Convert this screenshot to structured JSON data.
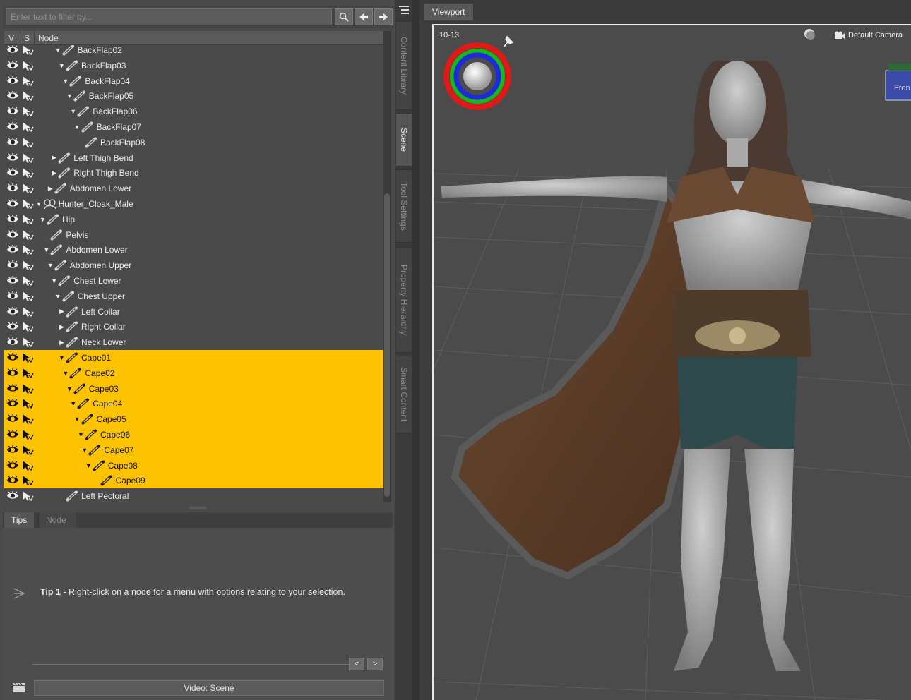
{
  "filter": {
    "placeholder": "Enter text to filter by..."
  },
  "tree_header": {
    "v": "V",
    "s": "S",
    "node": "Node"
  },
  "tree_rows": [
    {
      "label": "BackFlap02",
      "depth": 9,
      "expand": "down",
      "selected": false
    },
    {
      "label": "BackFlap03",
      "depth": 10,
      "expand": "down",
      "selected": false
    },
    {
      "label": "BackFlap04",
      "depth": 11,
      "expand": "down",
      "selected": false
    },
    {
      "label": "BackFlap05",
      "depth": 12,
      "expand": "down",
      "selected": false
    },
    {
      "label": "BackFlap06",
      "depth": 13,
      "expand": "down",
      "selected": false
    },
    {
      "label": "BackFlap07",
      "depth": 14,
      "expand": "down",
      "selected": false
    },
    {
      "label": "BackFlap08",
      "depth": 15,
      "expand": "none",
      "selected": false
    },
    {
      "label": "Left Thigh Bend",
      "depth": 8,
      "expand": "right",
      "selected": false
    },
    {
      "label": "Right Thigh Bend",
      "depth": 8,
      "expand": "right",
      "selected": false
    },
    {
      "label": "Abdomen Lower",
      "depth": 7,
      "expand": "right",
      "selected": false
    },
    {
      "label": "Hunter_Cloak_Male",
      "depth": 4,
      "expand": "down",
      "selected": false,
      "icon": "figure"
    },
    {
      "label": "Hip",
      "depth": 5,
      "expand": "down",
      "selected": false
    },
    {
      "label": "Pelvis",
      "depth": 6,
      "expand": "none",
      "selected": false
    },
    {
      "label": "Abdomen Lower",
      "depth": 6,
      "expand": "down",
      "selected": false
    },
    {
      "label": "Abdomen Upper",
      "depth": 7,
      "expand": "down",
      "selected": false
    },
    {
      "label": "Chest Lower",
      "depth": 8,
      "expand": "down",
      "selected": false
    },
    {
      "label": "Chest Upper",
      "depth": 9,
      "expand": "down",
      "selected": false
    },
    {
      "label": "Left Collar",
      "depth": 10,
      "expand": "right",
      "selected": false
    },
    {
      "label": "Right Collar",
      "depth": 10,
      "expand": "right",
      "selected": false
    },
    {
      "label": "Neck Lower",
      "depth": 10,
      "expand": "right",
      "selected": false
    },
    {
      "label": "Cape01",
      "depth": 10,
      "expand": "down",
      "selected": true
    },
    {
      "label": "Cape02",
      "depth": 11,
      "expand": "down",
      "selected": true
    },
    {
      "label": "Cape03",
      "depth": 12,
      "expand": "down",
      "selected": true
    },
    {
      "label": "Cape04",
      "depth": 13,
      "expand": "down",
      "selected": true
    },
    {
      "label": "Cape05",
      "depth": 14,
      "expand": "down",
      "selected": true
    },
    {
      "label": "Cape06",
      "depth": 15,
      "expand": "down",
      "selected": true
    },
    {
      "label": "Cape07",
      "depth": 16,
      "expand": "down",
      "selected": true
    },
    {
      "label": "Cape08",
      "depth": 17,
      "expand": "down",
      "selected": true
    },
    {
      "label": "Cape09",
      "depth": 19,
      "expand": "none",
      "selected": true
    },
    {
      "label": "Left Pectoral",
      "depth": 10,
      "expand": "none",
      "selected": false
    }
  ],
  "tips_panel": {
    "tab_tips": "Tips",
    "tab_node": "Node",
    "tip_prefix": "Tip 1",
    "tip_text": " - Right-click on a node for a menu with options relating to your selection.",
    "prev": "<",
    "next": ">",
    "video_button": "Video: Scene"
  },
  "side_tabs": [
    "Content Library",
    "Scene",
    "Tool Settings",
    "Property Hierarchy",
    "Smart Content"
  ],
  "active_side_tab": "Scene",
  "viewport": {
    "tab_label": "Viewport",
    "frame_counter": "10-13",
    "camera": "Default Camera",
    "view_cube_label": "Fron"
  },
  "colors": {
    "selection": "#fdc300",
    "panel_bg": "#4a4a4a",
    "text": "#e6e6e6"
  },
  "icons": [
    "search-icon",
    "arrow-left-icon",
    "arrow-right-icon",
    "eye-icon",
    "select-arrow-icon",
    "bone-icon",
    "figure-icon",
    "tip-icon",
    "clapperboard-icon",
    "camera-icon",
    "pin-icon",
    "light-icon",
    "panel-menu-icon"
  ]
}
